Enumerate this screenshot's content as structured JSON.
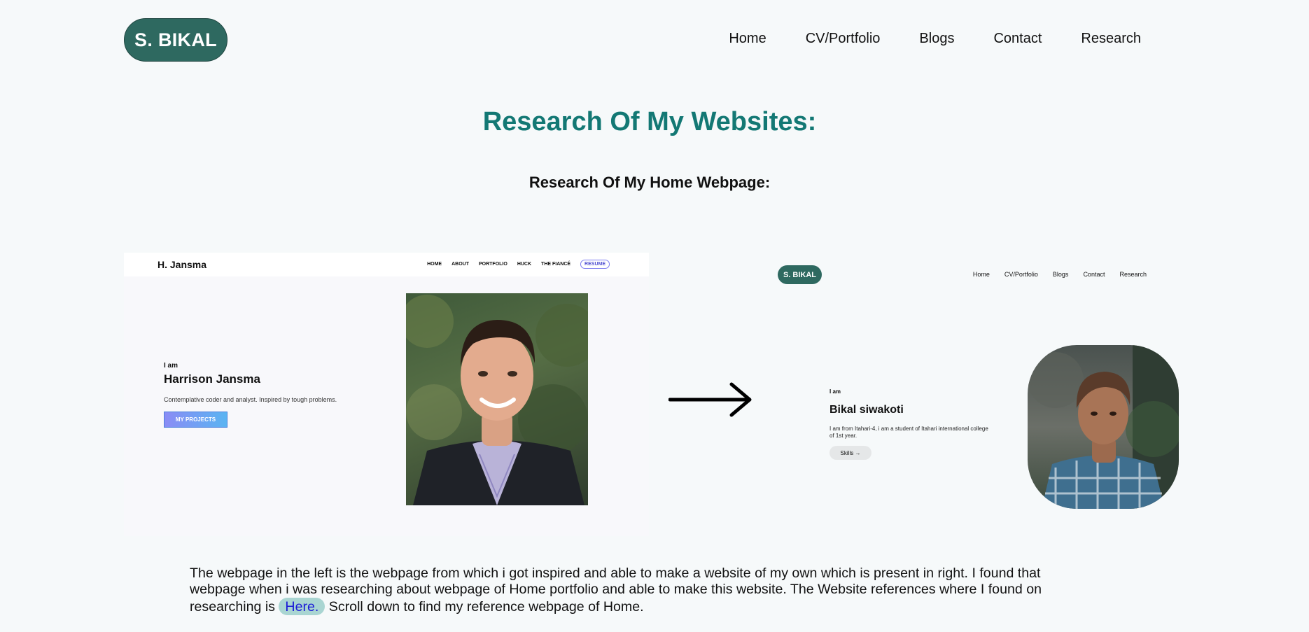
{
  "header": {
    "logo": "S. BIKAL",
    "nav": [
      "Home",
      "CV/Portfolio",
      "Blogs",
      "Contact",
      "Research"
    ]
  },
  "main": {
    "title": "Research Of My Websites:",
    "subtitle": "Research Of My Home Webpage:"
  },
  "reference_site": {
    "brand": "H. Jansma",
    "nav": [
      "HOME",
      "ABOUT",
      "PORTFOLIO",
      "HUCK",
      "THE FIANCÉ"
    ],
    "resume": "RESUME",
    "intro": "I am",
    "name": "Harrison Jansma",
    "tagline": "Contemplative coder and analyst. Inspired by tough problems.",
    "button": "MY PROJECTS"
  },
  "own_site": {
    "logo": "S. BIKAL",
    "nav": [
      "Home",
      "CV/Portfolio",
      "Blogs",
      "Contact",
      "Research"
    ],
    "intro": "I am",
    "name": "Bikal siwakoti",
    "description": "I am from Itahari-4, i am a student of Itahari international college of 1st year.",
    "button": "Skills →"
  },
  "paragraph": {
    "text_before": "The webpage in the left is the webpage from which i got inspired and able to make a website of my own which is present in right. I found that webpage when i was researching about webpage of Home portfolio and able to make this website. The Website references where I found on researching is ",
    "link": "Here.",
    "text_after": " Scroll down to find my reference webpage of Home."
  },
  "colors": {
    "accent": "#137874",
    "logo_bg": "#2e6960",
    "page_bg": "#f6f9fa",
    "link_bg": "#a9d5d2"
  }
}
